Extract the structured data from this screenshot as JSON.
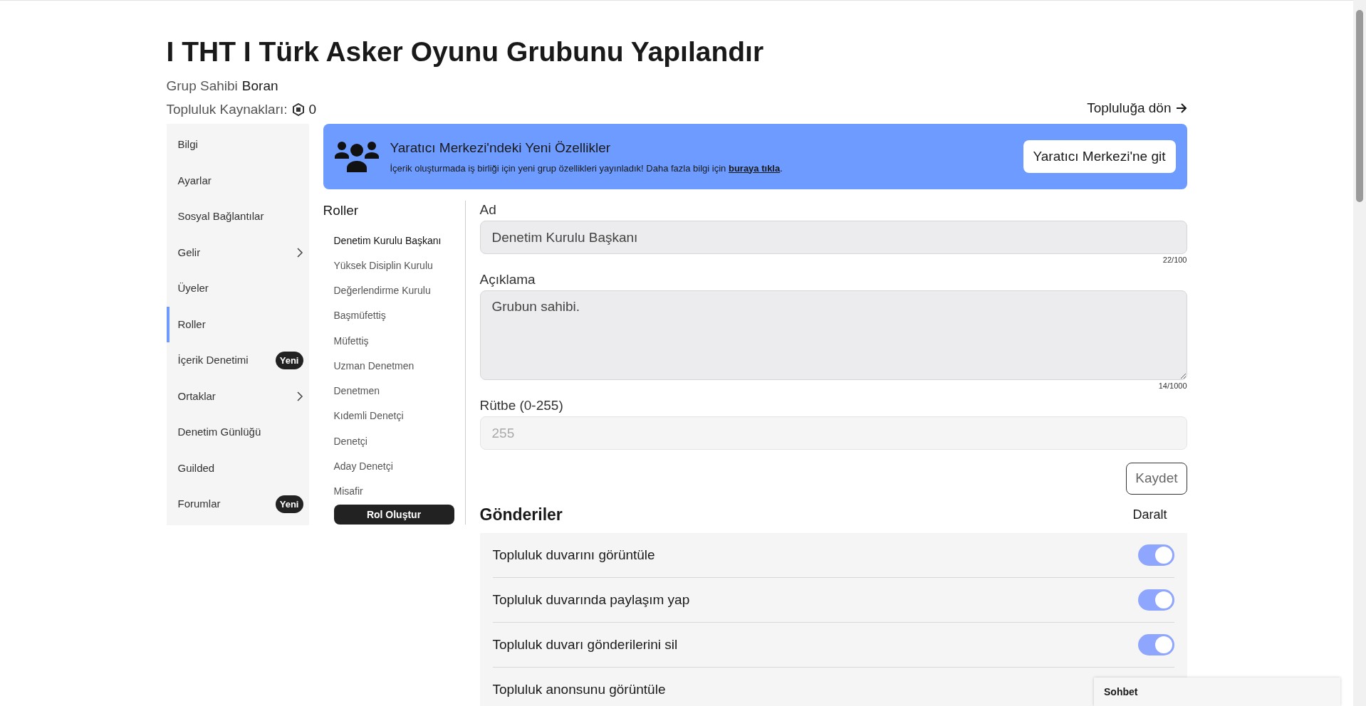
{
  "header": {
    "title": "I THT I Türk Asker Oyunu Grubunu Yapılandır",
    "owner_label": "Grup Sahibi",
    "owner_name": "Boran",
    "funds_label": "Topluluk Kaynakları:",
    "funds_value": "0",
    "back_link": "Topluluğa dön"
  },
  "sidebar": {
    "items": [
      {
        "label": "Bilgi",
        "selected": false,
        "expandable": false
      },
      {
        "label": "Ayarlar",
        "selected": false,
        "expandable": false
      },
      {
        "label": "Sosyal Bağlantılar",
        "selected": false,
        "expandable": false
      },
      {
        "label": "Gelir",
        "selected": false,
        "expandable": true
      },
      {
        "label": "Üyeler",
        "selected": false,
        "expandable": false
      },
      {
        "label": "Roller",
        "selected": true,
        "expandable": false
      },
      {
        "label": "İçerik Denetimi",
        "selected": false,
        "expandable": false,
        "badge": "Yeni"
      },
      {
        "label": "Ortaklar",
        "selected": false,
        "expandable": true
      },
      {
        "label": "Denetim Günlüğü",
        "selected": false,
        "expandable": false
      },
      {
        "label": "Guilded",
        "selected": false,
        "expandable": false
      },
      {
        "label": "Forumlar",
        "selected": false,
        "expandable": false,
        "badge": "Yeni"
      }
    ]
  },
  "banner": {
    "title": "Yaratıcı Merkezi'ndeki Yeni Özellikler",
    "text": "İçerik oluşturmada iş birliği için yeni grup özellikleri yayınladık! Daha fazla bilgi için",
    "link": "buraya tıkla",
    "text_end": ".",
    "button": "Yaratıcı Merkezi'ne git"
  },
  "roles": {
    "title": "Roller",
    "items": [
      {
        "label": "Denetim Kurulu Başkanı",
        "selected": true
      },
      {
        "label": "Yüksek Disiplin Kurulu",
        "selected": false
      },
      {
        "label": "Değerlendirme Kurulu",
        "selected": false
      },
      {
        "label": "Başmüfettiş",
        "selected": false
      },
      {
        "label": "Müfettiş",
        "selected": false
      },
      {
        "label": "Uzman Denetmen",
        "selected": false
      },
      {
        "label": "Denetmen",
        "selected": false
      },
      {
        "label": "Kıdemli Denetçi",
        "selected": false
      },
      {
        "label": "Denetçi",
        "selected": false
      },
      {
        "label": "Aday Denetçi",
        "selected": false
      },
      {
        "label": "Misafir",
        "selected": false
      }
    ],
    "create_button": "Rol Oluştur"
  },
  "form": {
    "name_label": "Ad",
    "name_value": "Denetim Kurulu Başkanı",
    "name_count": "22/100",
    "description_label": "Açıklama",
    "description_value": "Grubun sahibi.",
    "description_count": "14/1000",
    "rank_label": "Rütbe (0-255)",
    "rank_value": "255",
    "save_button": "Kaydet"
  },
  "permissions": {
    "title": "Gönderiler",
    "collapse": "Daralt",
    "items": [
      {
        "label": "Topluluk duvarını görüntüle",
        "on": true
      },
      {
        "label": "Topluluk duvarında paylaşım yap",
        "on": true
      },
      {
        "label": "Topluluk duvarı gönderilerini sil",
        "on": true
      },
      {
        "label": "Topluluk anonsunu görüntüle"
      }
    ]
  },
  "chat": {
    "title": "Sohbet"
  }
}
